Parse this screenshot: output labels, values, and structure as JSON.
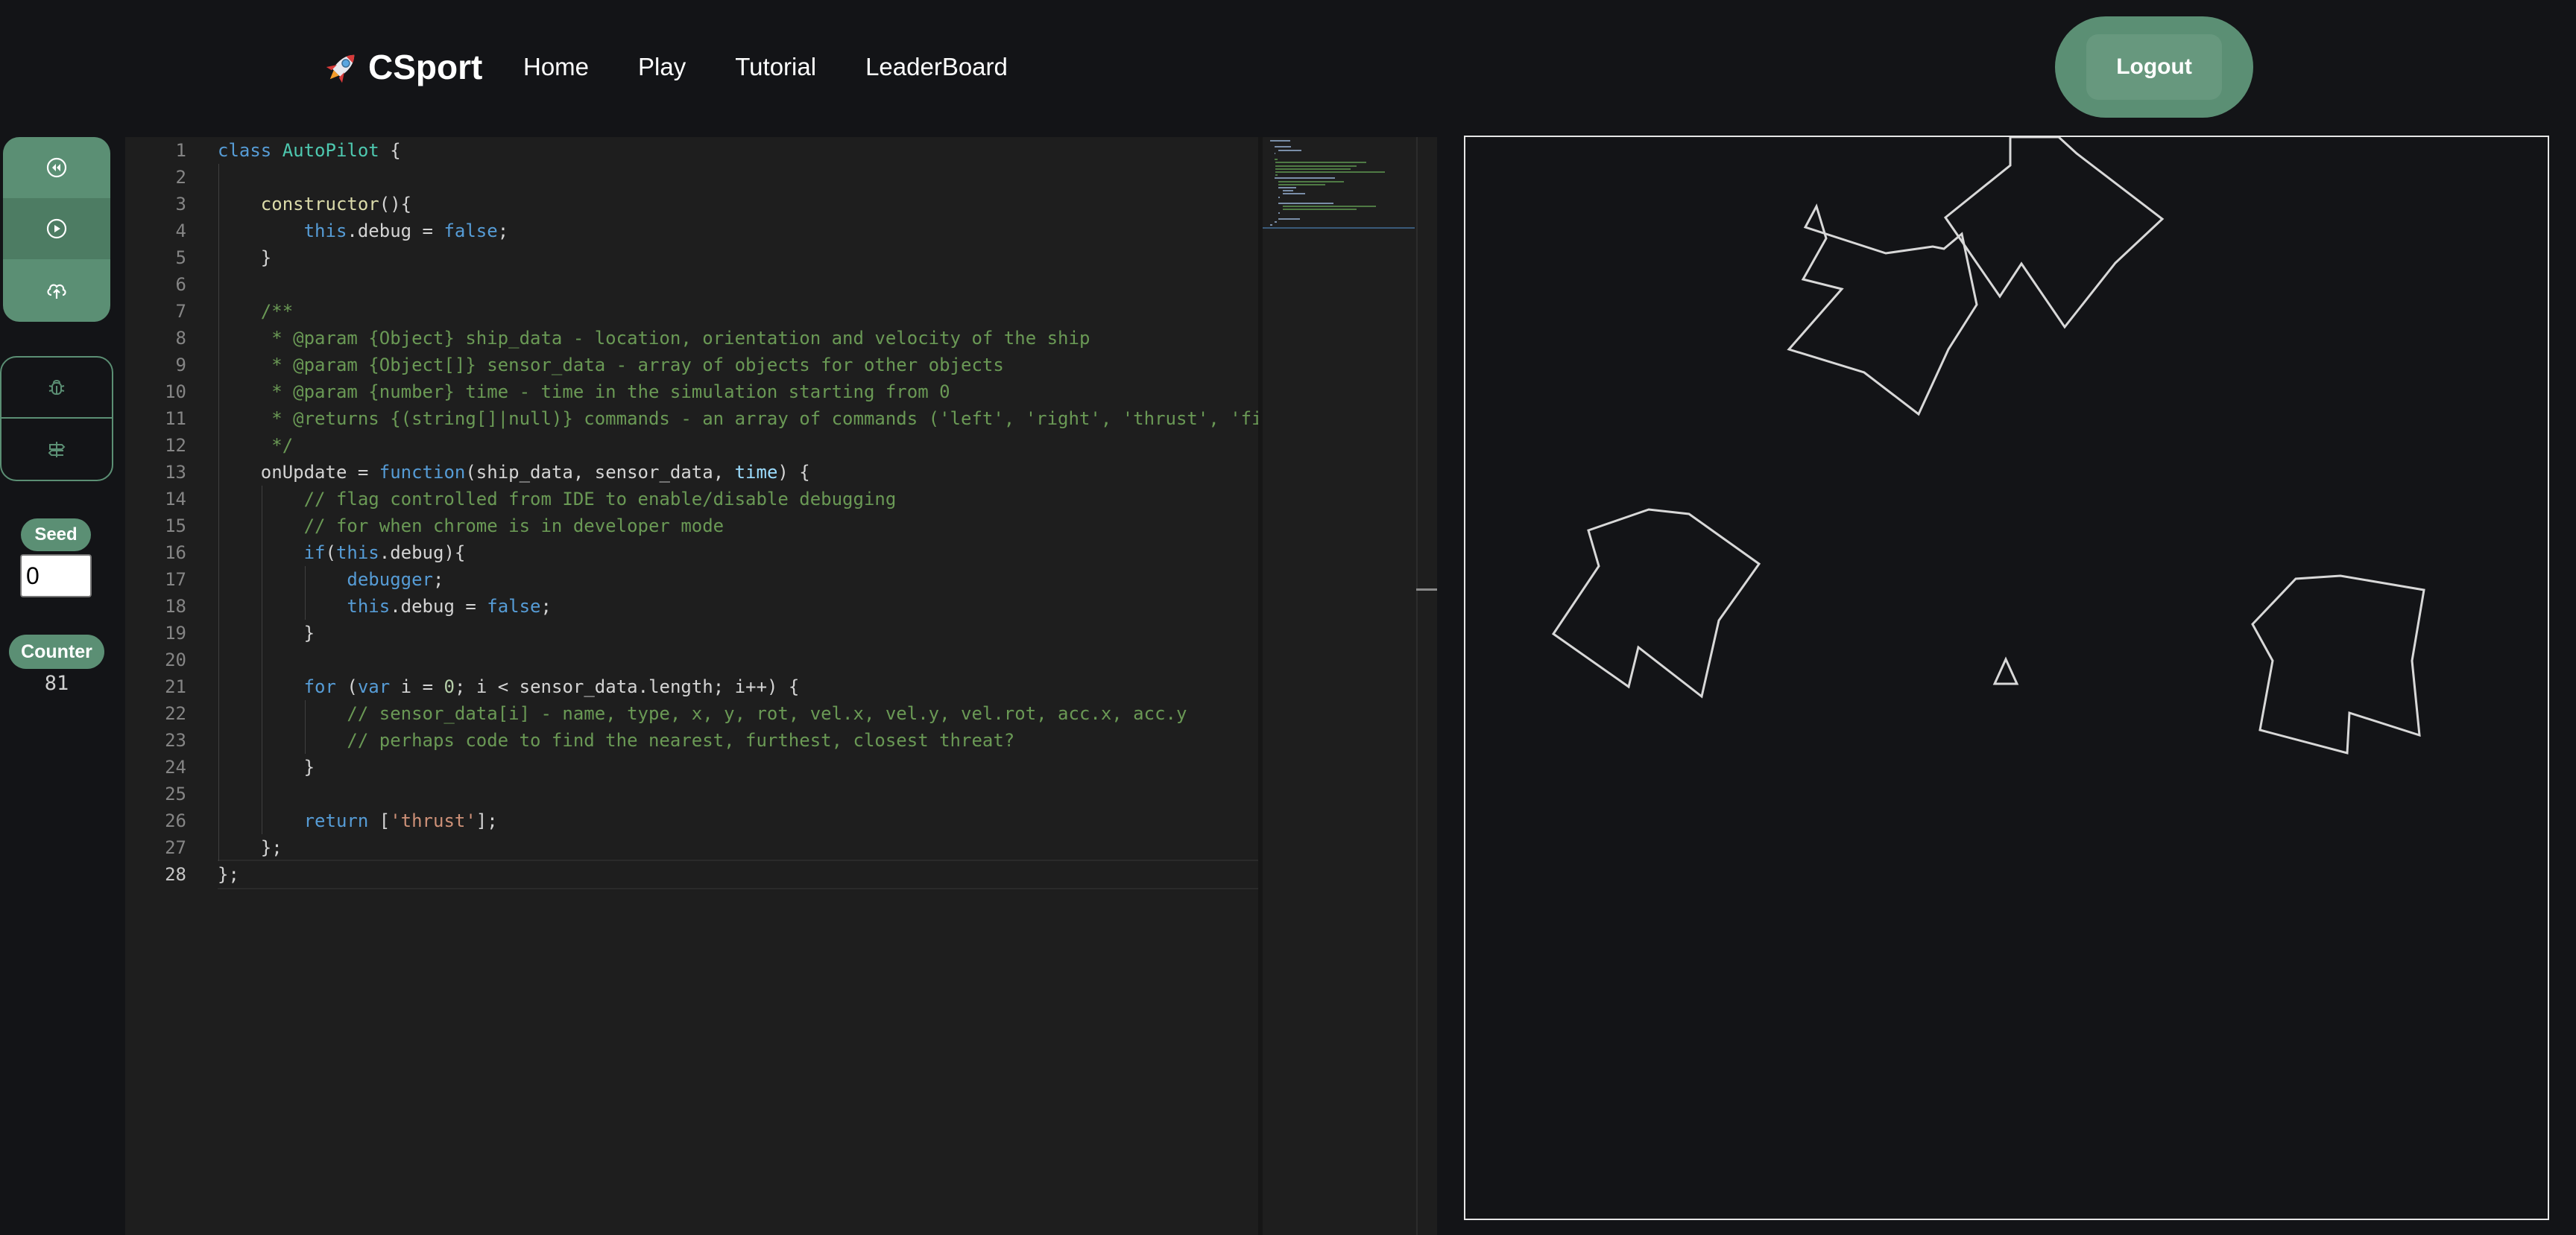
{
  "brand": {
    "name": "CSport",
    "icon": "rocket-icon"
  },
  "nav": {
    "items": [
      "Home",
      "Play",
      "Tutorial",
      "LeaderBoard"
    ]
  },
  "logout": {
    "label": "Logout"
  },
  "tools": {
    "group1": [
      "rewind-icon",
      "play-icon",
      "upload-cloud-icon"
    ],
    "group2": [
      "bug-icon",
      "signpost-icon"
    ]
  },
  "seed": {
    "label": "Seed",
    "value": "0"
  },
  "counter": {
    "label": "Counter",
    "value": "81"
  },
  "editor": {
    "current_line": 28,
    "lines": [
      "class AutoPilot {",
      "",
      "    constructor(){",
      "        this.debug = false;",
      "    }",
      "",
      "    /**",
      "     * @param {Object} ship_data - location, orientation and velocity of the ship",
      "     * @param {Object[]} sensor_data - array of objects for other objects",
      "     * @param {number} time - time in the simulation starting from 0",
      "     * @returns {(string[]|null)} commands - an array of commands ('left', 'right', 'thrust', 'fi",
      "     */",
      "    onUpdate = function(ship_data, sensor_data, time) {",
      "        // flag controlled from IDE to enable/disable debugging",
      "        // for when chrome is in developer mode",
      "        if(this.debug){",
      "            debugger;",
      "            this.debug = false;",
      "        }",
      "",
      "        for (var i = 0; i < sensor_data.length; i++) {",
      "            // sensor_data[i] - name, type, x, y, rot, vel.x, vel.y, vel.rot, acc.x, acc.y",
      "            // perhaps code to find the nearest, furthest, closest threat?",
      "        }",
      "",
      "        return ['thrust'];",
      "    };",
      "};"
    ]
  },
  "game": {
    "stroke_color": "#d8d8d8",
    "asteroids": 4,
    "ship": "triangle-ship"
  },
  "colors": {
    "accent": "#5b8f74",
    "background": "#131417",
    "editor_bg": "#1e1e1e"
  }
}
